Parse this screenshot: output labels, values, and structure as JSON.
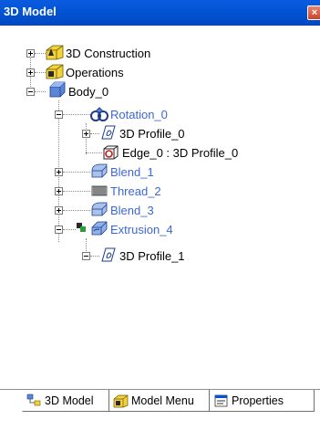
{
  "window": {
    "title": "3D Model",
    "close_glyph": "×"
  },
  "tree": {
    "nodes": [
      {
        "label": "3D Construction",
        "icon": "folder-construction-icon",
        "color": "black",
        "expander": "plus"
      },
      {
        "label": "Operations",
        "icon": "folder-operations-icon",
        "color": "black",
        "expander": "plus"
      },
      {
        "label": "Body_0",
        "icon": "cube-body-icon",
        "color": "black",
        "expander": "minus"
      },
      {
        "label": "Rotation_0",
        "icon": "rotation-icon",
        "color": "blue",
        "expander": "minus"
      },
      {
        "label": "3D Profile_0",
        "icon": "profile-icon",
        "color": "black",
        "expander": "plus"
      },
      {
        "label": "Edge_0 : 3D Profile_0",
        "icon": "edge-icon",
        "color": "black",
        "expander": "none"
      },
      {
        "label": "Blend_1",
        "icon": "blend-icon",
        "color": "blue",
        "expander": "plus"
      },
      {
        "label": "Thread_2",
        "icon": "thread-icon",
        "color": "blue",
        "expander": "plus"
      },
      {
        "label": "Blend_3",
        "icon": "blend-icon",
        "color": "blue",
        "expander": "plus"
      },
      {
        "label": "Extrusion_4",
        "icon": "extrusion-icon",
        "color": "blue",
        "expander": "minus"
      },
      {
        "label": "3D Profile_1",
        "icon": "profile-icon",
        "color": "black",
        "expander": "minus"
      }
    ]
  },
  "tabs": [
    {
      "label": "3D Model",
      "icon": "model-tree-icon",
      "active": true
    },
    {
      "label": "Model Menu",
      "icon": "model-menu-icon",
      "active": false
    },
    {
      "label": "Properties",
      "icon": "properties-icon",
      "active": false
    }
  ],
  "colors": {
    "title_bar": "#0354d4",
    "feature_blue": "#3b68d8",
    "folder_yellow": "#f3d23c",
    "body_blue": "#5b86d6"
  }
}
